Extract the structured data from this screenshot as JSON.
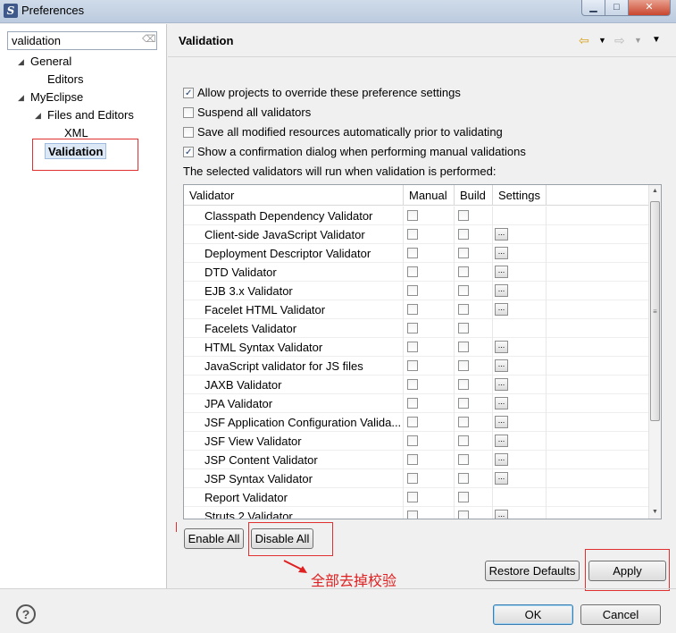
{
  "window": {
    "title": "Preferences",
    "min_icon": "minimize-icon",
    "max_icon": "maximize-icon",
    "close_icon": "close-icon"
  },
  "sidebar": {
    "filter_value": "validation",
    "tree": [
      {
        "label": "General",
        "expanded": true
      },
      {
        "label": "Editors"
      },
      {
        "label": "MyEclipse",
        "expanded": true
      },
      {
        "label": "Files and Editors",
        "expanded": true
      },
      {
        "label": "XML"
      },
      {
        "label": "Validation",
        "selected": true
      }
    ]
  },
  "page": {
    "title": "Validation",
    "options": [
      {
        "label": "Allow projects to override these preference settings",
        "checked": true
      },
      {
        "label": "Suspend all validators",
        "checked": false
      },
      {
        "label": "Save all modified resources automatically prior to validating",
        "checked": false
      },
      {
        "label": "Show a confirmation dialog when performing manual validations",
        "checked": true
      }
    ],
    "info_text": "The selected validators will run when validation is performed:"
  },
  "table": {
    "headers": {
      "validator": "Validator",
      "manual": "Manual",
      "build": "Build",
      "settings": "Settings"
    },
    "rows": [
      {
        "name": "Classpath Dependency Validator",
        "settings": false
      },
      {
        "name": "Client-side JavaScript Validator",
        "settings": true
      },
      {
        "name": "Deployment Descriptor Validator",
        "settings": true
      },
      {
        "name": "DTD Validator",
        "settings": true
      },
      {
        "name": "EJB 3.x Validator",
        "settings": true
      },
      {
        "name": "Facelet HTML Validator",
        "settings": true
      },
      {
        "name": "Facelets Validator",
        "settings": false
      },
      {
        "name": "HTML Syntax Validator",
        "settings": true
      },
      {
        "name": "JavaScript validator for JS files",
        "settings": true
      },
      {
        "name": "JAXB Validator",
        "settings": true
      },
      {
        "name": "JPA Validator",
        "settings": true
      },
      {
        "name": "JSF Application Configuration Valida...",
        "settings": true
      },
      {
        "name": "JSF View Validator",
        "settings": true
      },
      {
        "name": "JSP Content Validator",
        "settings": true
      },
      {
        "name": "JSP Syntax Validator",
        "settings": true
      },
      {
        "name": "Report Validator",
        "settings": false
      },
      {
        "name": "Struts 2 Validator",
        "settings": true
      }
    ],
    "settings_button_label": "..."
  },
  "buttons": {
    "enable_all": "Enable All",
    "disable_all": "Disable All",
    "restore_defaults": "Restore Defaults",
    "apply": "Apply",
    "ok": "OK",
    "cancel": "Cancel"
  },
  "annotation": {
    "text": "全部去掉校验",
    "color": "#e02020"
  },
  "colors": {
    "highlight_box": "#e03030",
    "selection": "#dce8f6"
  }
}
